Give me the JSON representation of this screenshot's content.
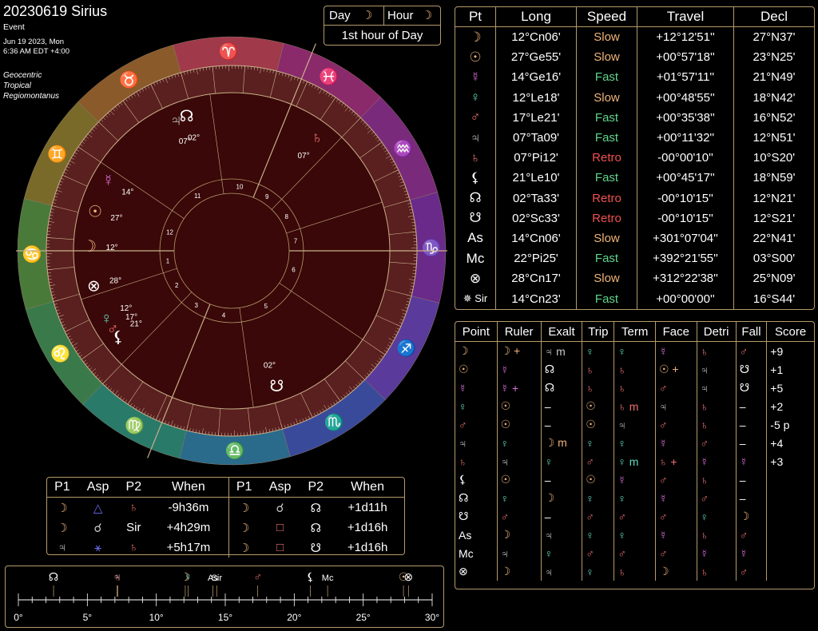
{
  "header": {
    "title": "20230619 Sirius",
    "subtitle": "Event",
    "date_line": "Jun 19 2023, Mon",
    "time_line": "6:36 AM EDT +4:00",
    "mode_lines": [
      "Geocentric",
      "Tropical",
      "Regiomontanus"
    ]
  },
  "day_hour": {
    "day_label": "Day",
    "hour_label": "Hour",
    "hour_text": "1st hour of Day"
  },
  "planets_table": {
    "headers": [
      "Pt",
      "Long",
      "Speed",
      "Travel",
      "Decl"
    ],
    "rows": [
      {
        "pt": "☽",
        "color": "#f0b47c",
        "long": "12°Cn06'",
        "speed": "Slow",
        "travel": "+12°12'51''",
        "decl": "27°N37'"
      },
      {
        "pt": "☉",
        "color": "#f0b47c",
        "long": "27°Ge55'",
        "speed": "Slow",
        "travel": "+00°57'18''",
        "decl": "23°N25'"
      },
      {
        "pt": "☿",
        "color": "#e070e0",
        "long": "14°Ge16'",
        "speed": "Fast",
        "travel": "+01°57'11''",
        "decl": "21°N49'"
      },
      {
        "pt": "♀",
        "color": "#60d8c0",
        "long": "12°Le18'",
        "speed": "Slow",
        "travel": "+00°48'55''",
        "decl": "18°N42'"
      },
      {
        "pt": "♂",
        "color": "#f07070",
        "long": "17°Le21'",
        "speed": "Fast",
        "travel": "+00°35'38''",
        "decl": "16°N52'"
      },
      {
        "pt": "♃",
        "color": "#c8c8c8",
        "long": "07°Ta09'",
        "speed": "Fast",
        "travel": "+00°11'32''",
        "decl": "12°N51'"
      },
      {
        "pt": "♄",
        "color": "#f07070",
        "long": "07°Pi12'",
        "speed": "Retro",
        "travel": "-00°00'10''",
        "decl": "10°S20'"
      },
      {
        "pt": "⚸",
        "color": "#ffffff",
        "long": "21°Le10'",
        "speed": "Fast",
        "travel": "+00°45'17''",
        "decl": "18°N59'"
      },
      {
        "pt": "☊",
        "color": "#ffffff",
        "long": "02°Ta33'",
        "speed": "Retro",
        "travel": "-00°10'15''",
        "decl": "12°N21'"
      },
      {
        "pt": "☋",
        "color": "#ffffff",
        "long": "02°Sc33'",
        "speed": "Retro",
        "travel": "-00°10'15''",
        "decl": "12°S21'"
      },
      {
        "pt": "As",
        "color": "#ffffff",
        "long": "14°Cn06'",
        "speed": "Slow",
        "travel": "+301°07'04''",
        "decl": "22°N41'"
      },
      {
        "pt": "Mc",
        "color": "#ffffff",
        "long": "22°Pi25'",
        "speed": "Fast",
        "travel": "+392°21'55''",
        "decl": "03°S00'"
      },
      {
        "pt": "⊗",
        "color": "#ffffff",
        "long": "28°Cn17'",
        "speed": "Slow",
        "travel": "+312°22'38''",
        "decl": "25°N09'"
      },
      {
        "pt": "✵ Sir",
        "color": "#ffffff",
        "long": "14°Cn23'",
        "speed": "Fast",
        "travel": "+00°00'00''",
        "decl": "16°S44'"
      }
    ]
  },
  "dignity_table": {
    "headers": [
      "Point",
      "Ruler",
      "Exalt",
      "Trip",
      "Term",
      "Face",
      "Detri",
      "Fall",
      "Score"
    ],
    "rows": [
      [
        "☽",
        "☽ +",
        "♃ m",
        "♀",
        "♀",
        "☿",
        "♄",
        "♂",
        "+9"
      ],
      [
        "☉",
        "☿",
        "☊",
        "♄",
        "♄",
        "☉ +",
        "♃",
        "☋",
        "+1"
      ],
      [
        "☿",
        "☿ +",
        "☊",
        "♄",
        "♄",
        "♂",
        "♃",
        "☋",
        "+5"
      ],
      [
        "♀",
        "☉",
        "–",
        "☉",
        "♄ m",
        "♃",
        "♄",
        "–",
        "+2"
      ],
      [
        "♂",
        "☉",
        "–",
        "☉",
        "♃",
        "♂",
        "♄",
        "–",
        "-5 p"
      ],
      [
        "♃",
        "♀",
        "☽ m",
        "♀",
        "♀",
        "☿",
        "♂",
        "–",
        "+4"
      ],
      [
        "♄",
        "♃",
        "♀",
        "♂",
        "♀ m",
        "♄ +",
        "☿",
        "☿",
        "+3"
      ],
      [
        "⚸",
        "☉",
        "–",
        "☉",
        "☿",
        "♂",
        "♄",
        "–",
        ""
      ],
      [
        "☊",
        "♀",
        "☽",
        "♀",
        "♀",
        "☿",
        "♂",
        "–",
        ""
      ],
      [
        "☋",
        "♂",
        "–",
        "♂",
        "♂",
        "♂",
        "♀",
        "☽",
        ""
      ],
      [
        "As",
        "☽",
        "♃",
        "♀",
        "♀",
        "☿",
        "♄",
        "♂",
        ""
      ],
      [
        "Mc",
        "♃",
        "♀",
        "♂",
        "♂",
        "♂",
        "☿",
        "☿",
        ""
      ],
      [
        "⊗",
        "☽",
        "♃",
        "♀",
        "♄",
        "☽",
        "♄",
        "♂",
        ""
      ]
    ]
  },
  "aspects_table": {
    "headers": [
      "P1",
      "Asp",
      "P2",
      "When",
      "P1",
      "Asp",
      "P2",
      "When"
    ],
    "rows": [
      [
        "☽",
        "△",
        "♄",
        "-9h36m",
        "☽",
        "☌",
        "☊",
        "+1d11h"
      ],
      [
        "☽",
        "☌",
        "Sir",
        "+4h29m",
        "☽",
        "□",
        "☊",
        "+1d16h"
      ],
      [
        "♃",
        "⚹",
        "♄",
        "+5h17m",
        "☽",
        "□",
        "☋",
        "+1d16h"
      ]
    ]
  },
  "degree_strip": {
    "axis_labels": [
      "0°",
      "5°",
      "10°",
      "15°",
      "20°",
      "25°",
      "30°"
    ],
    "markers": [
      {
        "glyph": "☊",
        "deg": 2.55
      },
      {
        "glyph": "♃",
        "deg": 7.15
      },
      {
        "glyph": "♄",
        "deg": 7.2
      },
      {
        "glyph": "☽",
        "deg": 12.1
      },
      {
        "glyph": "♀",
        "deg": 12.3
      },
      {
        "glyph": "As",
        "deg": 14.1
      },
      {
        "glyph": "Sir",
        "deg": 14.38
      },
      {
        "glyph": "♂",
        "deg": 17.35
      },
      {
        "glyph": "⚸",
        "deg": 21.17
      },
      {
        "glyph": "Mc",
        "deg": 22.42
      },
      {
        "glyph": "☉",
        "deg": 27.92
      },
      {
        "glyph": "⊗",
        "deg": 28.28
      }
    ]
  },
  "wheel": {
    "ascendant_deg": 104.1,
    "sign_glyphs": [
      "♈",
      "♉",
      "♊",
      "♋",
      "♌",
      "♍",
      "♎",
      "♏",
      "♐",
      "♑",
      "♒",
      "♓"
    ],
    "sign_colors": [
      "#a0394a",
      "#8a5a2a",
      "#7a6a2a",
      "#4a7a3a",
      "#3a7a4a",
      "#2a7a6a",
      "#2a6a8a",
      "#3a4a9a",
      "#5a3a9a",
      "#6a2a8a",
      "#7a2a7a",
      "#8a2a6a"
    ],
    "house_numbers": [
      "1",
      "2",
      "3",
      "4",
      "5",
      "6",
      "7",
      "8",
      "9",
      "10",
      "11",
      "12"
    ],
    "house_cusps_deg": [
      104.1,
      122,
      150,
      172,
      202,
      250,
      284.1,
      302,
      330,
      352,
      22,
      70
    ],
    "planets": [
      {
        "glyph": "☽",
        "deg": 102.1,
        "label": "12°",
        "color": "#f0b47c"
      },
      {
        "glyph": "☉",
        "deg": 87.92,
        "label": "27°",
        "color": "#f0b47c"
      },
      {
        "glyph": "☿",
        "deg": 74.27,
        "label": "14°",
        "color": "#e070e0"
      },
      {
        "glyph": "♀",
        "deg": 132.3,
        "label": "12°",
        "color": "#60d8c0"
      },
      {
        "glyph": "♂",
        "deg": 137.35,
        "label": "17°",
        "color": "#f07070"
      },
      {
        "glyph": "⚸",
        "deg": 141.17,
        "label": "21°",
        "color": "#ffffff"
      },
      {
        "glyph": "♃",
        "deg": 37.15,
        "label": "07°",
        "color": "#c8c8c8"
      },
      {
        "glyph": "☊",
        "deg": 32.55,
        "label": "02°",
        "color": "#ffffff"
      },
      {
        "glyph": "♄",
        "deg": 337.2,
        "label": "07°",
        "color": "#f07070"
      },
      {
        "glyph": "☋",
        "deg": 212.55,
        "label": "02°",
        "color": "#ffffff"
      },
      {
        "glyph": "⊗",
        "deg": 118.28,
        "label": "28°",
        "color": "#ffffff"
      }
    ]
  }
}
